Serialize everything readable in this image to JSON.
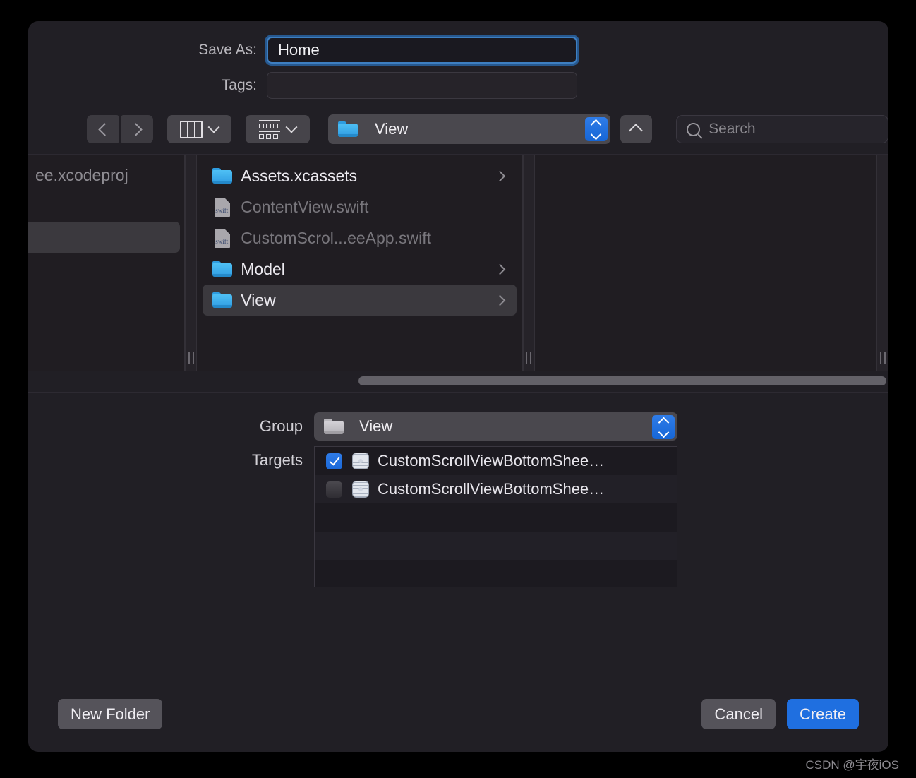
{
  "dialog": {
    "save_as_label": "Save As:",
    "save_as_value": "Home",
    "tags_label": "Tags:",
    "tags_value": ""
  },
  "toolbar": {
    "back_icon": "chevron-left-icon",
    "forward_icon": "chevron-right-icon",
    "view_mode_icon": "column-view-icon",
    "group_by_icon": "grid-group-icon",
    "path_label": "View",
    "path_icon": "blue-folder-icon",
    "stepper_icon": "up-down-stepper-icon",
    "up_icon": "chevron-up-icon",
    "search_placeholder": "Search",
    "search_icon": "search-icon"
  },
  "browser": {
    "column0": {
      "truncated_label": "ee.xcodeproj",
      "rows": [
        {
          "chevron": true,
          "selected": false
        },
        {
          "chevron": true,
          "selected": true
        }
      ]
    },
    "column1": {
      "items": [
        {
          "name": "Assets.xcassets",
          "icon": "blue-folder-icon",
          "type": "folder",
          "dimmed": false,
          "chevron": true,
          "selected": false
        },
        {
          "name": "ContentView.swift",
          "icon": "swift-file-icon",
          "type": "file",
          "dimmed": true,
          "chevron": false,
          "selected": false
        },
        {
          "name": "CustomScrol...eeApp.swift",
          "icon": "swift-file-icon",
          "type": "file",
          "dimmed": true,
          "chevron": false,
          "selected": false
        },
        {
          "name": "Model",
          "icon": "blue-folder-icon",
          "type": "folder",
          "dimmed": false,
          "chevron": true,
          "selected": false
        },
        {
          "name": "View",
          "icon": "blue-folder-icon",
          "type": "folder",
          "dimmed": false,
          "chevron": true,
          "selected": true
        }
      ]
    },
    "column2": {
      "items": []
    }
  },
  "options": {
    "group_label": "Group",
    "group_value": "View",
    "group_icon": "gray-folder-icon",
    "targets_label": "Targets",
    "targets": [
      {
        "name": "CustomScrollViewBottomShee…",
        "checked": true,
        "icon": "xcode-target-icon"
      },
      {
        "name": "CustomScrollViewBottomShee…",
        "checked": false,
        "icon": "xcode-target-icon"
      }
    ]
  },
  "buttons": {
    "new_folder": "New Folder",
    "cancel": "Cancel",
    "create": "Create"
  },
  "watermark": "CSDN @宇夜iOS",
  "colors": {
    "accent_blue": "#1f6fe0",
    "focus_ring": "#3e7fc1",
    "dialog_bg": "#211f25",
    "panel_bg": "#201d22",
    "selection_gray": "#3b393e",
    "folder_blue": "#2f9ce2"
  }
}
